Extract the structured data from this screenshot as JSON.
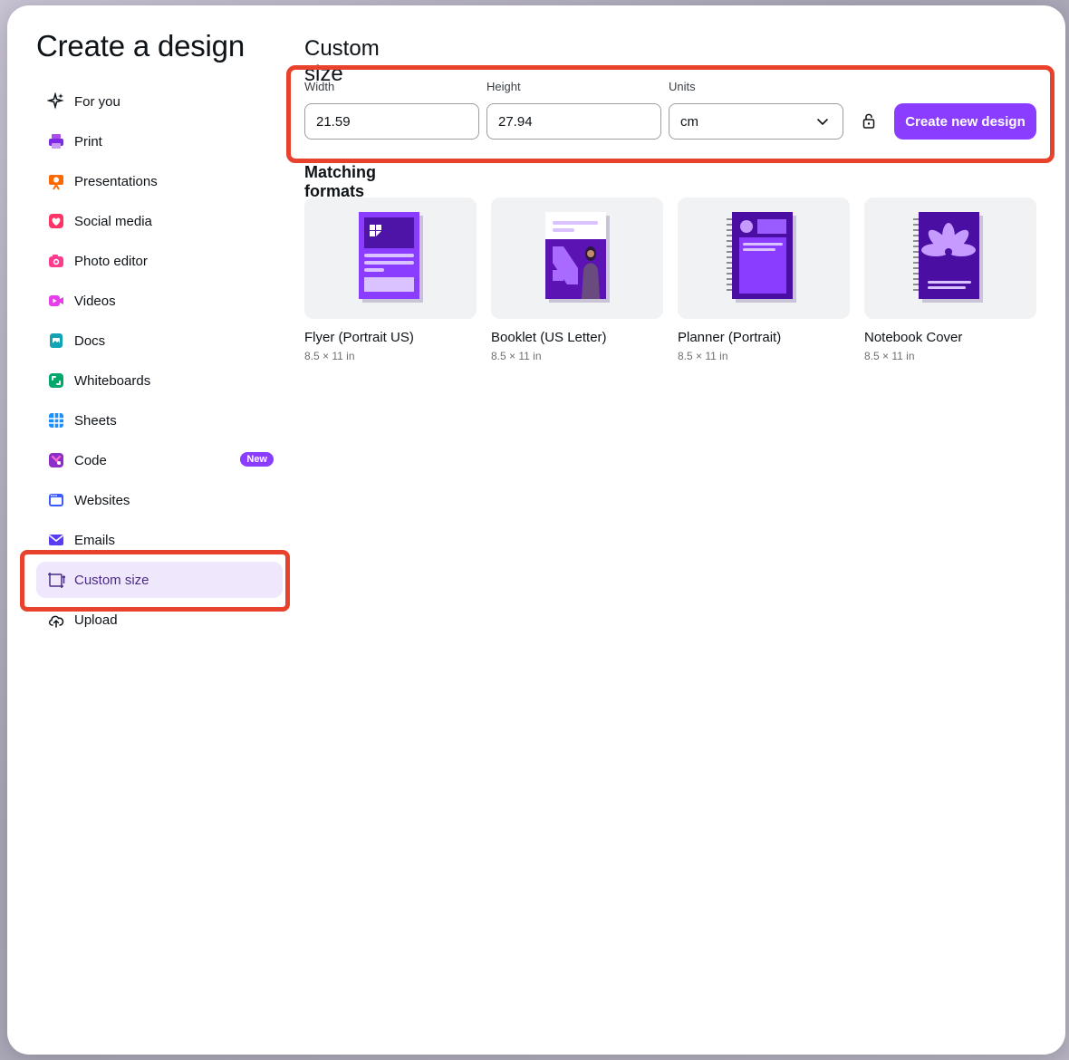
{
  "title": "Create a design",
  "nav": [
    {
      "label": "For you",
      "icon": "sparkle-icon"
    },
    {
      "label": "Print",
      "icon": "printer-icon"
    },
    {
      "label": "Presentations",
      "icon": "presentation-icon"
    },
    {
      "label": "Social media",
      "icon": "heart-icon"
    },
    {
      "label": "Photo editor",
      "icon": "camera-icon"
    },
    {
      "label": "Videos",
      "icon": "video-icon"
    },
    {
      "label": "Docs",
      "icon": "doc-icon"
    },
    {
      "label": "Whiteboards",
      "icon": "whiteboard-icon"
    },
    {
      "label": "Sheets",
      "icon": "sheet-icon"
    },
    {
      "label": "Code",
      "icon": "code-icon",
      "badge": "New"
    },
    {
      "label": "Websites",
      "icon": "website-icon"
    },
    {
      "label": "Emails",
      "icon": "email-icon"
    },
    {
      "label": "Custom size",
      "icon": "custom-size-icon"
    },
    {
      "label": "Upload",
      "icon": "upload-cloud-icon"
    }
  ],
  "custom": {
    "heading": "Custom size",
    "width_label": "Width",
    "width_value": "21.59",
    "height_label": "Height",
    "height_value": "27.94",
    "units_label": "Units",
    "units_value": "cm",
    "create_button": "Create new design"
  },
  "matching": {
    "heading": "Matching formats",
    "items": [
      {
        "title": "Flyer (Portrait US)",
        "size": "8.5 × 11 in"
      },
      {
        "title": "Booklet (US Letter)",
        "size": "8.5 × 11 in"
      },
      {
        "title": "Planner (Portrait)",
        "size": "8.5 × 11 in"
      },
      {
        "title": "Notebook Cover",
        "size": "8.5 × 11 in"
      }
    ]
  },
  "colors": {
    "accent": "#8b3dff",
    "highlight": "#e8412c",
    "active_bg": "#efe8fd"
  }
}
